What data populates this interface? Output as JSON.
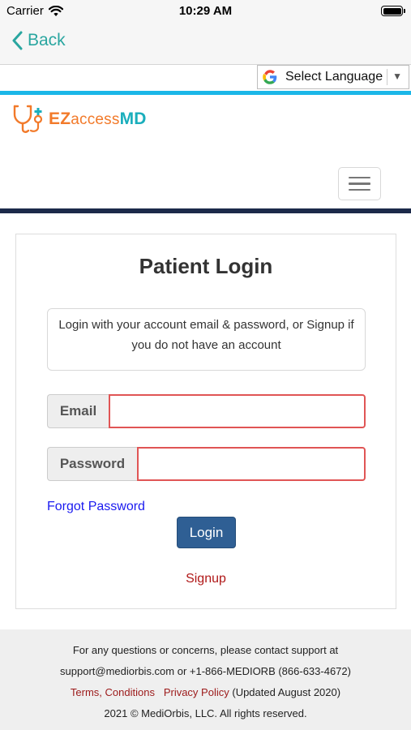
{
  "status_bar": {
    "carrier": "Carrier",
    "time": "10:29 AM"
  },
  "nav": {
    "back_label": "Back"
  },
  "translate": {
    "label": "Select Language",
    "caret": "▼"
  },
  "brand": {
    "ez": "EZ",
    "access": "access",
    "md": "MD"
  },
  "login": {
    "title": "Patient Login",
    "info": "Login with your account email & password, or Signup if you do not have an account",
    "email_label": "Email",
    "email_value": "",
    "password_label": "Password",
    "password_value": "",
    "forgot_label": "Forgot Password",
    "login_button": "Login",
    "signup_label": "Signup"
  },
  "footer": {
    "line1": "For any questions or concerns, please contact support at",
    "line2": "support@mediorbis.com or +1-866-MEDIORB (866-633-4672)",
    "terms_link": "Terms, Conditions",
    "privacy_link": "Privacy Policy",
    "updated": "(Updated August 2020)",
    "copyright": "2021 © MediOrbis, LLC. All rights reserved."
  },
  "colors": {
    "accent_teal": "#2aa6a0",
    "brand_orange": "#f27a2a",
    "brand_teal": "#1aaebc",
    "cyan_bar": "#1bb7e8",
    "navy_bar": "#1c2a4a",
    "login_button": "#2f5f94",
    "error_border": "#e05555",
    "link_blue": "#1a1af0",
    "link_red": "#b01818"
  }
}
